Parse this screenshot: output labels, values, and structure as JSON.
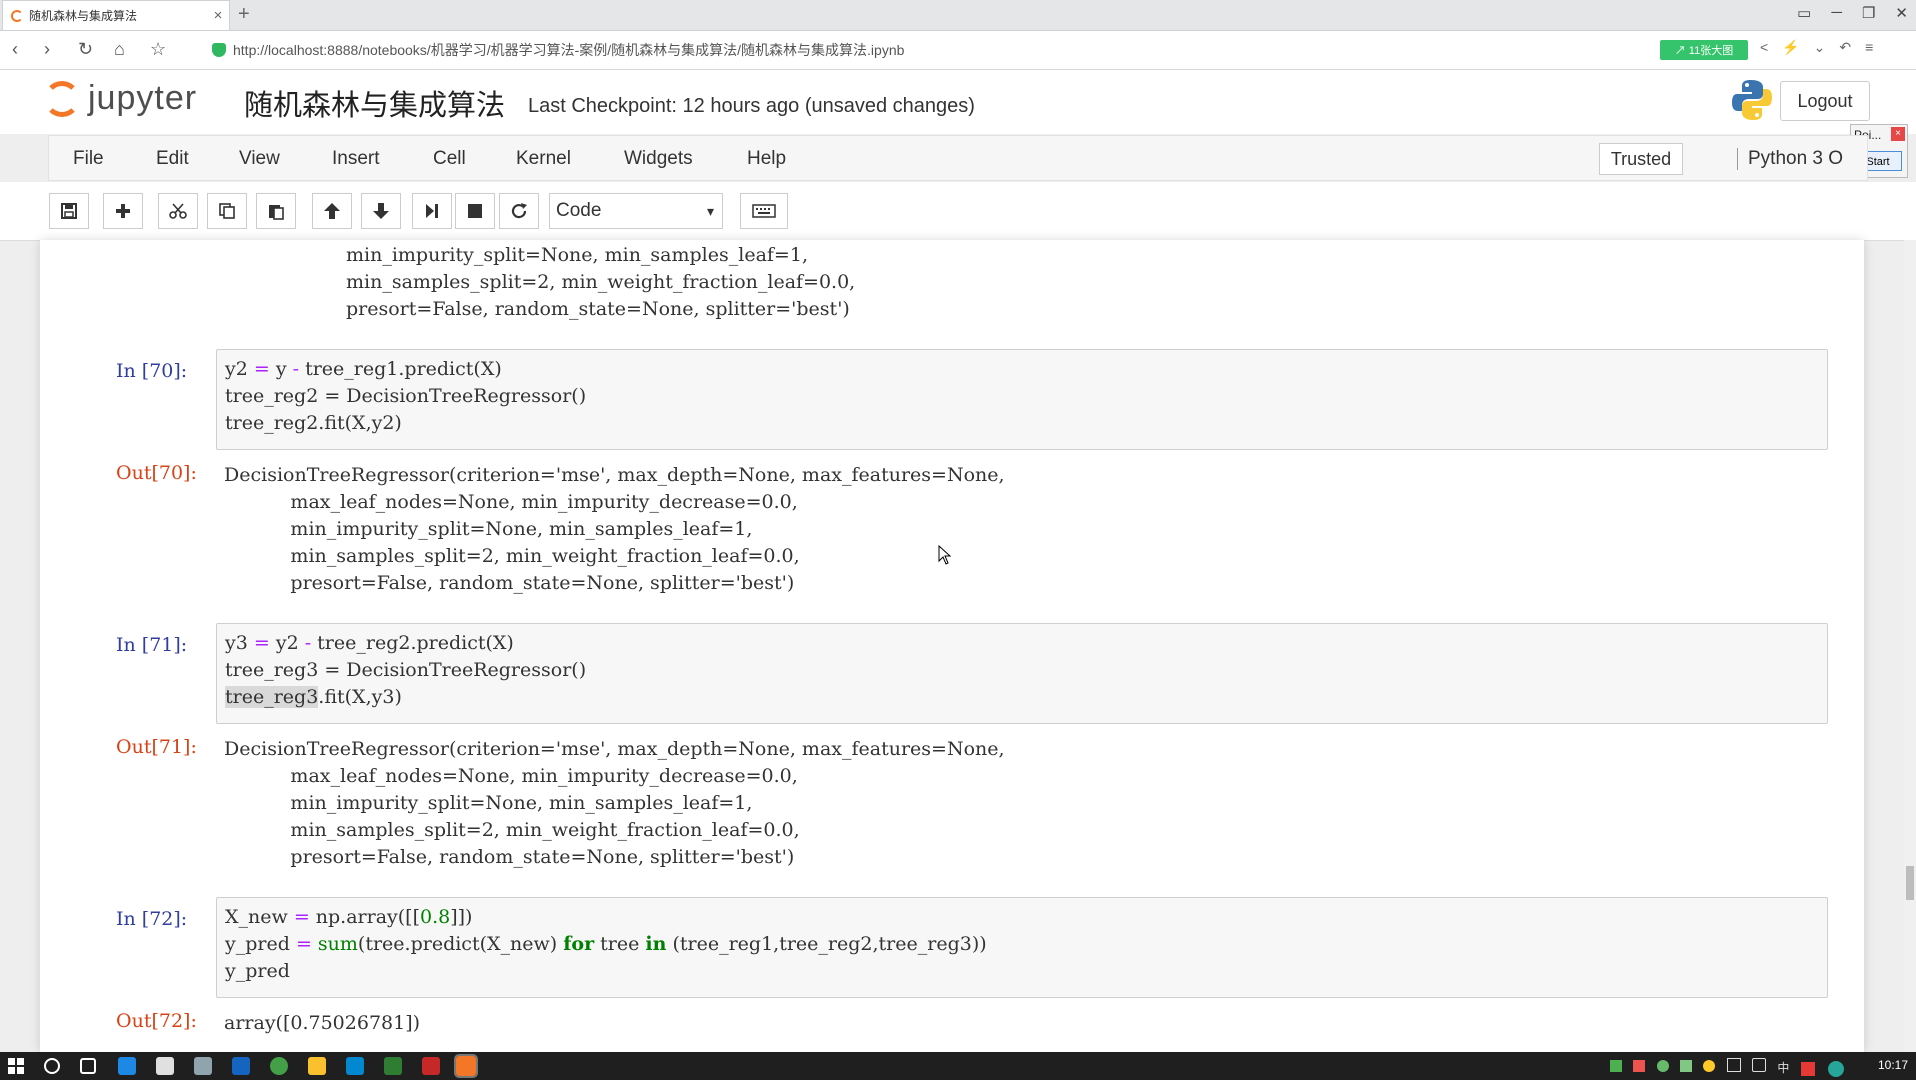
{
  "browser": {
    "tab_title": "随机森林与集成算法",
    "tab_close": "×",
    "new_tab": "+",
    "window_controls": [
      "▭",
      "─",
      "❐",
      "✕"
    ],
    "nav_icons": [
      "‹",
      "›",
      "↻",
      "⌂",
      "☆"
    ],
    "url_host": "http://localhost",
    "url_rest": ":8888/notebooks/机器学习/机器学习算法-案例/随机森林与集成算法/随机森林与集成算法.ipynb",
    "badge": "↗ 11张大图",
    "right_icons": [
      "<",
      "⚡",
      "⌄",
      "↶",
      "≡"
    ]
  },
  "jupyter": {
    "logo_text": "jupyter",
    "notebook_name": "随机森林与集成算法",
    "checkpoint": "Last Checkpoint: 12 hours ago (unsaved changes)",
    "logout_label": "Logout",
    "trusted_label": "Trusted",
    "kernel_label": "Python 3",
    "kernel_indicator": "O",
    "menu": [
      "File",
      "Edit",
      "View",
      "Insert",
      "Cell",
      "Kernel",
      "Widgets",
      "Help"
    ],
    "cell_type": "Code",
    "caret": "▾"
  },
  "popup": {
    "label": "Poi...",
    "close": "×",
    "start": "Start"
  },
  "cells": {
    "out69_tail": [
      "min_impurity_split=None, min_samples_leaf=1,",
      "min_samples_split=2, min_weight_fraction_leaf=0.0,",
      "presort=False, random_state=None, splitter='best')"
    ],
    "in70_prompt": "In [70]:",
    "in70_line2": "tree_reg2 = DecisionTreeRegressor()",
    "in70_line3": "tree_reg2.fit(X,y2)",
    "out70_prompt": "Out[70]:",
    "out70": [
      "DecisionTreeRegressor(criterion='mse', max_depth=None, max_features=None,",
      "           max_leaf_nodes=None, min_impurity_decrease=0.0,",
      "           min_impurity_split=None, min_samples_leaf=1,",
      "           min_samples_split=2, min_weight_fraction_leaf=0.0,",
      "           presort=False, random_state=None, splitter='best')"
    ],
    "in71_prompt": "In [71]:",
    "in71_line2": "tree_reg3 = DecisionTreeRegressor()",
    "in71_line3_hl": "tree_reg3",
    "in71_line3_rest": ".fit(X,y3)",
    "out71_prompt": "Out[71]:",
    "out71": [
      "DecisionTreeRegressor(criterion='mse', max_depth=None, max_features=None,",
      "           max_leaf_nodes=None, min_impurity_decrease=0.0,",
      "           min_impurity_split=None, min_samples_leaf=1,",
      "           min_samples_split=2, min_weight_fraction_leaf=0.0,",
      "           presort=False, random_state=None, splitter='best')"
    ],
    "in72_prompt": "In [72]:",
    "in72_line3": "y_pred",
    "out72_prompt": "Out[72]:",
    "out72": "array([0.75026781])"
  },
  "taskbar": {
    "tray_text": "中",
    "clock": "10:17"
  }
}
